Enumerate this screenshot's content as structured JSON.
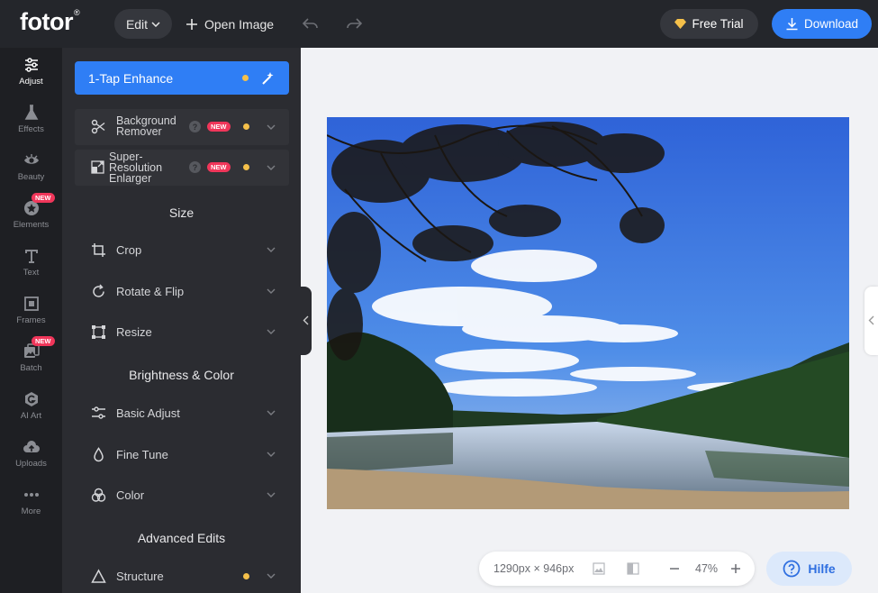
{
  "header": {
    "logo": "fotor",
    "logo_mark": "®",
    "edit_label": "Edit",
    "open_image_label": "Open Image",
    "free_trial_label": "Free Trial",
    "download_label": "Download"
  },
  "rail": {
    "items": [
      {
        "label": "Adjust",
        "icon": "sliders-icon"
      },
      {
        "label": "Effects",
        "icon": "flask-icon"
      },
      {
        "label": "Beauty",
        "icon": "eye-icon"
      },
      {
        "label": "Elements",
        "icon": "star-icon",
        "badge": "NEW"
      },
      {
        "label": "Text",
        "icon": "text-icon"
      },
      {
        "label": "Frames",
        "icon": "frame-icon"
      },
      {
        "label": "Batch",
        "icon": "batch-icon",
        "badge": "NEW"
      },
      {
        "label": "AI Art",
        "icon": "ai-art-icon"
      },
      {
        "label": "Uploads",
        "icon": "cloud-upload-icon"
      },
      {
        "label": "More",
        "icon": "more-dots-icon"
      }
    ]
  },
  "panel": {
    "enhance_label": "1-Tap Enhance",
    "bg_remover": {
      "line1": "Background",
      "line2": "Remover",
      "badge": "NEW"
    },
    "super_res": {
      "line1": "Super-",
      "line2": "Resolution",
      "line3": "Enlarger",
      "badge": "NEW"
    },
    "size_title": "Size",
    "crop": "Crop",
    "rotate": "Rotate & Flip",
    "resize": "Resize",
    "brightness_title": "Brightness & Color",
    "basic_adjust": "Basic Adjust",
    "fine_tune": "Fine Tune",
    "color": "Color",
    "advanced_title": "Advanced Edits",
    "structure": "Structure",
    "help_char": "?"
  },
  "footer": {
    "dimensions": "1290px × 946px",
    "zoom": "47%",
    "help_label": "Hilfe"
  },
  "colors": {
    "accent": "#2f7ef5",
    "badge": "#f0365a",
    "dot": "#f5c04a"
  }
}
